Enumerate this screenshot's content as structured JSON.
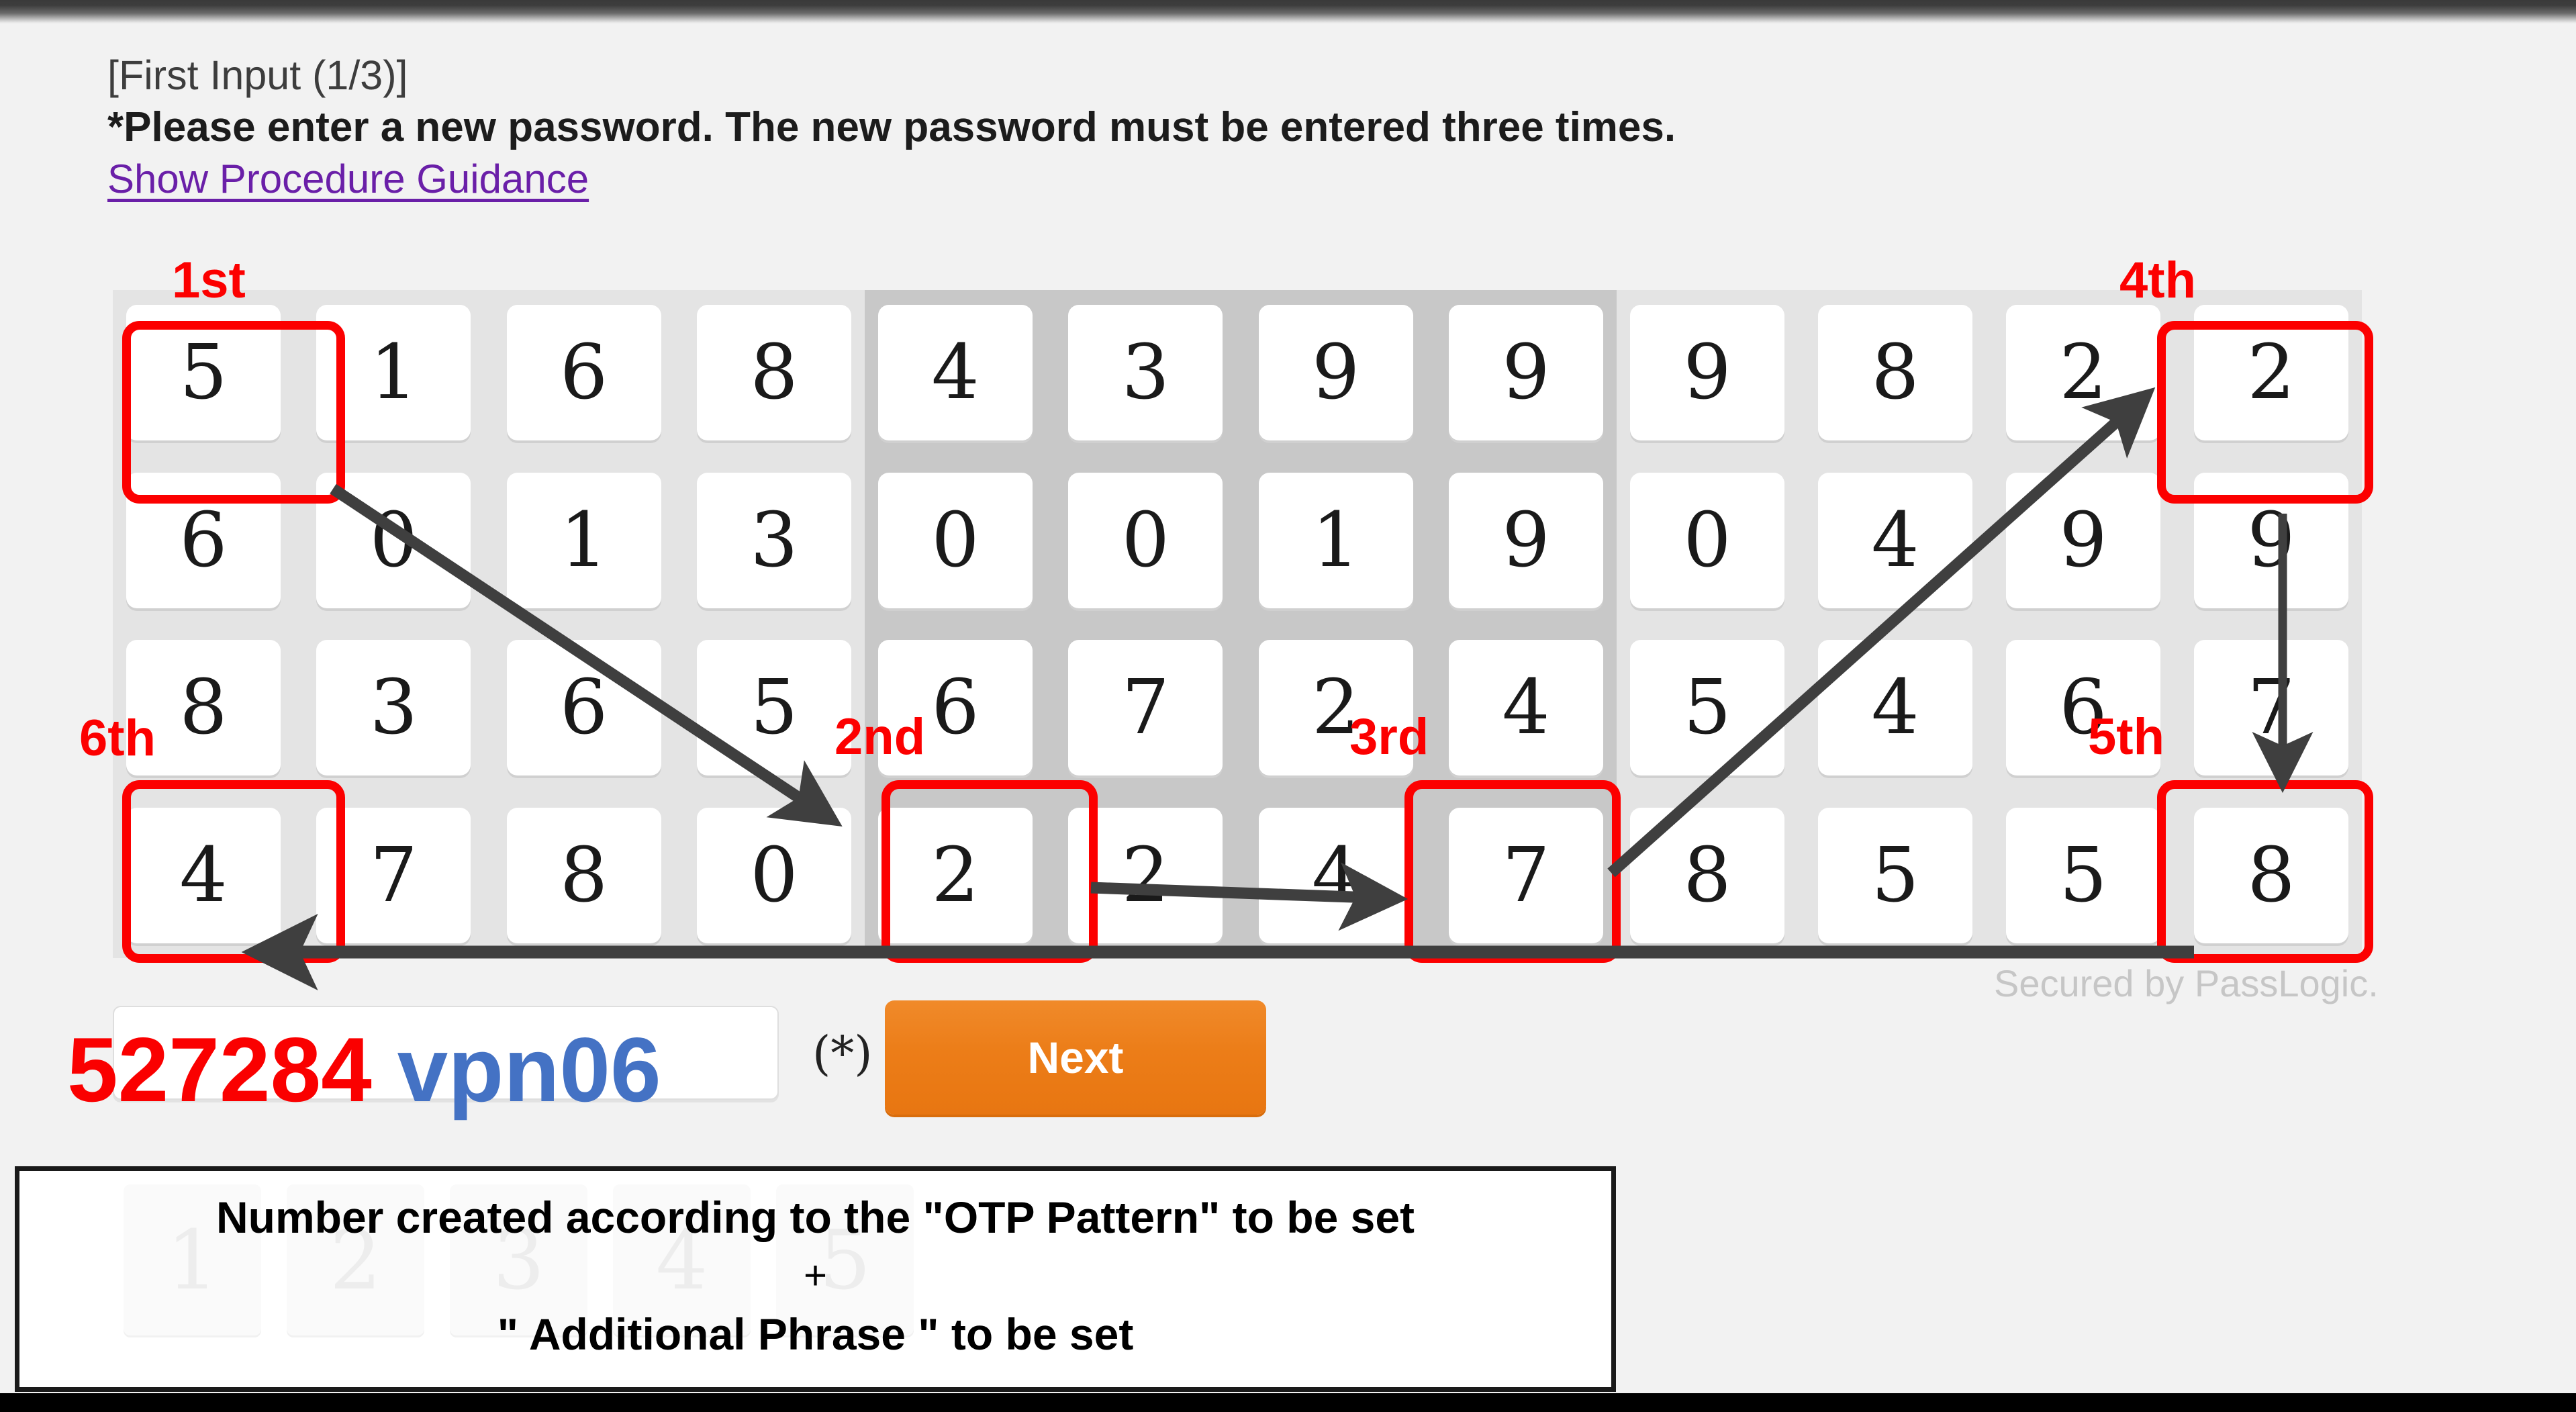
{
  "header": {
    "step": "[First Input (1/3)]",
    "instruction": "*Please enter a new password. The new password must be entered three times.",
    "link": "Show Procedure Guidance"
  },
  "keypad": {
    "panels": [
      {
        "shade": "light",
        "rows": [
          [
            "5",
            "1",
            "6",
            "8"
          ],
          [
            "6",
            "0",
            "1",
            "3"
          ],
          [
            "8",
            "3",
            "6",
            "5"
          ],
          [
            "4",
            "7",
            "8",
            "0"
          ]
        ]
      },
      {
        "shade": "dark",
        "rows": [
          [
            "4",
            "3",
            "9",
            "9"
          ],
          [
            "0",
            "0",
            "1",
            "9"
          ],
          [
            "6",
            "7",
            "2",
            "4"
          ],
          [
            "2",
            "2",
            "4",
            "7"
          ]
        ]
      },
      {
        "shade": "light",
        "rows": [
          [
            "9",
            "8",
            "2",
            "2"
          ],
          [
            "0",
            "4",
            "9",
            "9"
          ],
          [
            "5",
            "4",
            "6",
            "7"
          ],
          [
            "8",
            "5",
            "5",
            "8"
          ]
        ]
      }
    ],
    "secured_label": "Secured by PassLogic."
  },
  "annotations": {
    "accent_color": "#fc0000",
    "arrow_color": "#3f3f3f",
    "ordinals": [
      {
        "label": "1st",
        "panel": 1,
        "row": 1,
        "col": 1,
        "value": "5"
      },
      {
        "label": "2nd",
        "panel": 2,
        "row": 4,
        "col": 1,
        "value": "2"
      },
      {
        "label": "3rd",
        "panel": 2,
        "row": 4,
        "col": 4,
        "value": "7"
      },
      {
        "label": "4th",
        "panel": 3,
        "row": 1,
        "col": 4,
        "value": "2"
      },
      {
        "label": "5th",
        "panel": 3,
        "row": 4,
        "col": 4,
        "value": "8"
      },
      {
        "label": "6th",
        "panel": 1,
        "row": 4,
        "col": 1,
        "value": "4"
      }
    ]
  },
  "form": {
    "otp_number": "527284",
    "otp_phrase": "vpn06",
    "required_marker": "(*)",
    "next_label": "Next",
    "input_value": "",
    "input_placeholder": ""
  },
  "caption": {
    "line1": "Number created according to the \"OTP Pattern\" to be set",
    "plus": "+",
    "line2": "\" Additional Phrase \" to be set",
    "watermark_digits": [
      "1",
      "2",
      "3",
      "4",
      "5"
    ]
  },
  "colors": {
    "background": "#f2f2f2",
    "panel_light": "#e4e4e4",
    "panel_dark": "#c8c8c8",
    "link": "#6a1fa8",
    "otp_number": "#fa0000",
    "otp_phrase": "#4472c4",
    "next_button": "#ec7d18",
    "secured_text": "#c6c6c6"
  }
}
